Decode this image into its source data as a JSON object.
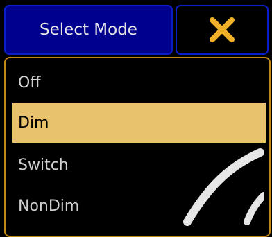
{
  "dialog": {
    "title": "Select Mode",
    "close_icon": "close-x-icon",
    "accent_color": "#f0b02a",
    "title_bg": "#00008e",
    "selected_bg": "#e8c26d"
  },
  "modes": {
    "items": [
      {
        "label": "Off",
        "selected": false
      },
      {
        "label": "Dim",
        "selected": true
      },
      {
        "label": "Switch",
        "selected": false
      },
      {
        "label": "NonDim",
        "selected": false
      }
    ]
  }
}
